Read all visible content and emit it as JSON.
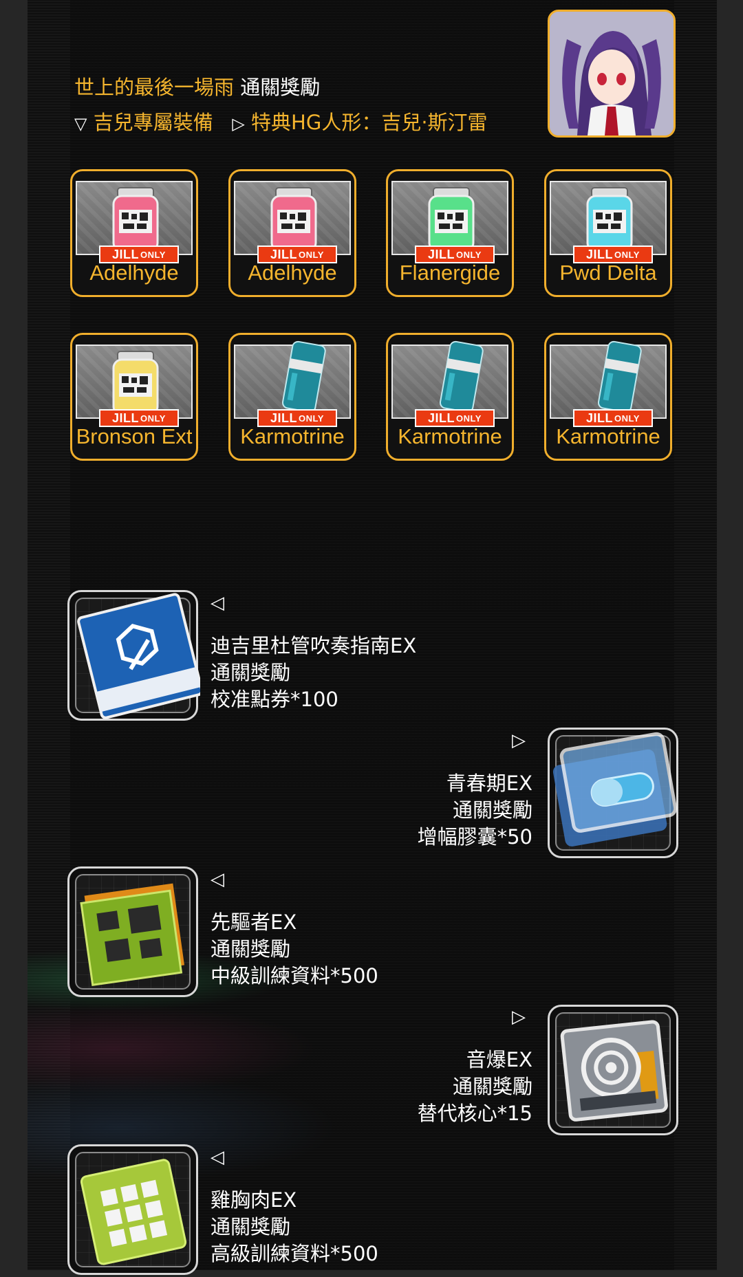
{
  "header": {
    "title_main": "世上的最後一場雨",
    "title_suffix": "通關獎勵",
    "left_marker": "▽",
    "left_label": "吉兒專屬裝備",
    "right_marker": "▷",
    "right_label": "特典HG人形：吉兒·斯汀雷"
  },
  "badge": {
    "jill": "JILL",
    "only": "ONLY"
  },
  "gear_items": [
    {
      "name": "Adelhyde",
      "type": "jar",
      "color": "#f06a8c"
    },
    {
      "name": "Adelhyde",
      "type": "jar",
      "color": "#f06a8c"
    },
    {
      "name": "Flanergide",
      "type": "jar",
      "color": "#58e08a"
    },
    {
      "name": "Pwd Delta",
      "type": "jar",
      "color": "#5ad6e8"
    },
    {
      "name": "Bronson Ext",
      "type": "jar",
      "color": "#f4dc6a"
    },
    {
      "name": "Karmotrine",
      "type": "can",
      "color": "#1f8a9a"
    },
    {
      "name": "Karmotrine",
      "type": "can",
      "color": "#1f8a9a"
    },
    {
      "name": "Karmotrine",
      "type": "can",
      "color": "#1f8a9a"
    }
  ],
  "rewards": [
    {
      "marker": "◁",
      "stage": "迪吉里杜管吹奏指南EX",
      "label": "通關獎勵",
      "item": "校准點券*100",
      "icon": "manual-icon"
    },
    {
      "marker": "▷",
      "stage": "青春期EX",
      "label": "通關獎勵",
      "item": "增幅膠囊*50",
      "icon": "capsule-cube-icon"
    },
    {
      "marker": "◁",
      "stage": "先驅者EX",
      "label": "通關獎勵",
      "item": "中級訓練資料*500",
      "icon": "circuit-board-icon"
    },
    {
      "marker": "▷",
      "stage": "音爆EX",
      "label": "通關獎勵",
      "item": "替代核心*15",
      "icon": "core-cube-icon"
    },
    {
      "marker": "◁",
      "stage": "雞胸肉EX",
      "label": "通關獎勵",
      "item": "高級訓練資料*500",
      "icon": "data-chip-icon"
    }
  ],
  "colors": {
    "gold": "#f5b52e",
    "frame": "#f0ae2c",
    "badge_red": "#ea3a12"
  }
}
